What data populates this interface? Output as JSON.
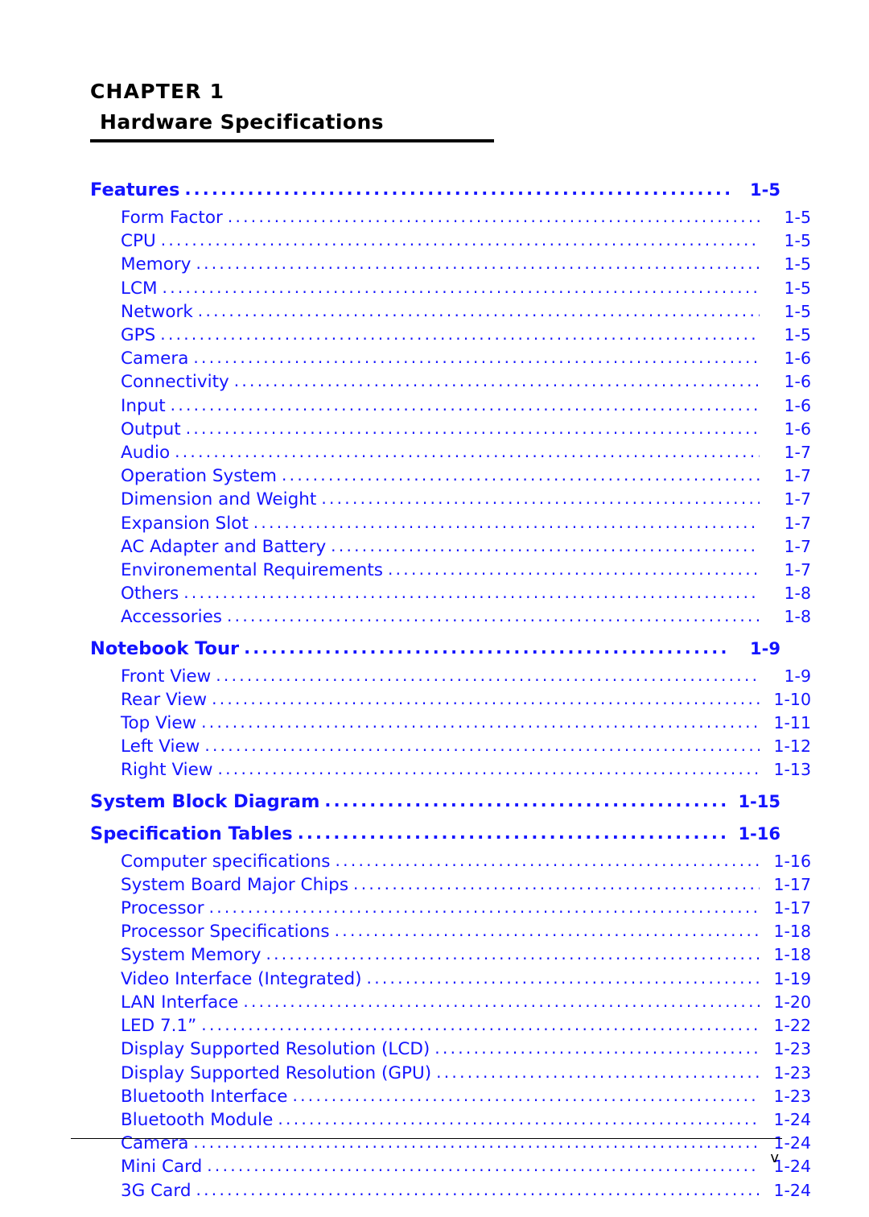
{
  "chapter": {
    "label": "CHAPTER 1",
    "title": "Hardware Specifications"
  },
  "colors": {
    "toc_link": "#1414ff",
    "text": "#000000"
  },
  "toc": [
    {
      "level": 1,
      "label": "Features",
      "page": "1-5"
    },
    {
      "level": 2,
      "label": "Form Factor",
      "page": "1-5"
    },
    {
      "level": 2,
      "label": "CPU",
      "page": "1-5"
    },
    {
      "level": 2,
      "label": "Memory",
      "page": "1-5"
    },
    {
      "level": 2,
      "label": "LCM",
      "page": "1-5"
    },
    {
      "level": 2,
      "label": "Network",
      "page": "1-5"
    },
    {
      "level": 2,
      "label": "GPS",
      "page": "1-5"
    },
    {
      "level": 2,
      "label": "Camera",
      "page": "1-6"
    },
    {
      "level": 2,
      "label": "Connectivity",
      "page": "1-6"
    },
    {
      "level": 2,
      "label": "Input",
      "page": "1-6"
    },
    {
      "level": 2,
      "label": "Output",
      "page": "1-6"
    },
    {
      "level": 2,
      "label": "Audio",
      "page": "1-7"
    },
    {
      "level": 2,
      "label": "Operation System",
      "page": "1-7"
    },
    {
      "level": 2,
      "label": "Dimension and Weight",
      "page": "1-7"
    },
    {
      "level": 2,
      "label": "Expansion Slot",
      "page": "1-7"
    },
    {
      "level": 2,
      "label": "AC Adapter and Battery",
      "page": "1-7"
    },
    {
      "level": 2,
      "label": "Environemental Requirements",
      "page": "1-7"
    },
    {
      "level": 2,
      "label": "Others",
      "page": "1-8"
    },
    {
      "level": 2,
      "label": "Accessories",
      "page": "1-8"
    },
    {
      "level": 1,
      "label": "Notebook Tour",
      "page": "1-9"
    },
    {
      "level": 2,
      "label": "Front View",
      "page": "1-9"
    },
    {
      "level": 2,
      "label": "Rear View",
      "page": "1-10"
    },
    {
      "level": 2,
      "label": "Top View",
      "page": "1-11"
    },
    {
      "level": 2,
      "label": "Left View",
      "page": "1-12"
    },
    {
      "level": 2,
      "label": "Right View",
      "page": "1-13"
    },
    {
      "level": 1,
      "label": "System Block Diagram",
      "page": "1-15"
    },
    {
      "level": 1,
      "label": "Specification Tables",
      "page": "1-16"
    },
    {
      "level": 2,
      "label": "Computer specifications",
      "page": "1-16"
    },
    {
      "level": 2,
      "label": "System Board Major Chips",
      "page": "1-17"
    },
    {
      "level": 2,
      "label": "Processor",
      "page": "1-17"
    },
    {
      "level": 2,
      "label": "Processor Specifications",
      "page": "1-18"
    },
    {
      "level": 2,
      "label": "System Memory",
      "page": "1-18"
    },
    {
      "level": 2,
      "label": "Video Interface (Integrated)",
      "page": "1-19"
    },
    {
      "level": 2,
      "label": "LAN Interface",
      "page": "1-20"
    },
    {
      "level": 2,
      "label": "LED 7.1”",
      "page": "1-22"
    },
    {
      "level": 2,
      "label": "Display Supported Resolution (LCD)",
      "page": "1-23"
    },
    {
      "level": 2,
      "label": "Display Supported Resolution (GPU)",
      "page": "1-23"
    },
    {
      "level": 2,
      "label": "Bluetooth Interface",
      "page": "1-23"
    },
    {
      "level": 2,
      "label": "Bluetooth Module",
      "page": "1-24"
    },
    {
      "level": 2,
      "label": "Camera",
      "page": "1-24"
    },
    {
      "level": 2,
      "label": "Mini Card",
      "page": "1-24"
    },
    {
      "level": 2,
      "label": "3G Card",
      "page": "1-24"
    }
  ],
  "footer": {
    "folio": "v"
  }
}
